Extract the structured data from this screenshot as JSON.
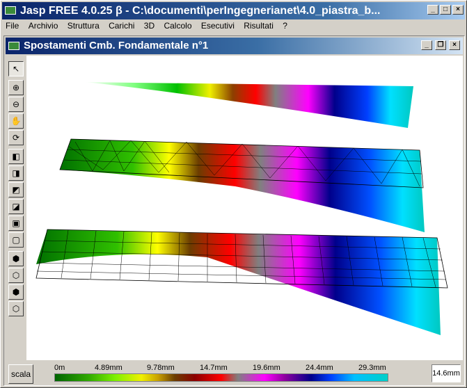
{
  "window": {
    "title": "Jasp FREE 4.0.25 β - C:\\documenti\\perIngegnerianet\\4.0_piastra_b..."
  },
  "menu": [
    "File",
    "Archivio",
    "Struttura",
    "Carichi",
    "3D",
    "Calcolo",
    "Esecutivi",
    "Risultati",
    "?"
  ],
  "child_window": {
    "title": "Spostamenti Cmb. Fondamentale n°1"
  },
  "legend": {
    "ticks": [
      "0m",
      "4.89mm",
      "9.78mm",
      "14.7mm",
      "19.6mm",
      "24.4mm",
      "29.3mm"
    ],
    "scale_button": "scala",
    "value": "14.6mm"
  },
  "icons": {
    "toolbar": [
      "pointer-icon",
      "zoom-in-icon",
      "zoom-out-icon",
      "pan-hand-icon",
      "rotate-icon",
      "view-front-icon",
      "view-back-icon",
      "view-left-icon",
      "view-right-icon",
      "view-top-icon",
      "view-bottom-icon",
      "view-iso1-icon",
      "view-iso2-icon",
      "view-iso3-icon",
      "view-iso4-icon"
    ]
  },
  "colors": {
    "title_active": "#0a246a",
    "canvas": "#ffffff"
  }
}
